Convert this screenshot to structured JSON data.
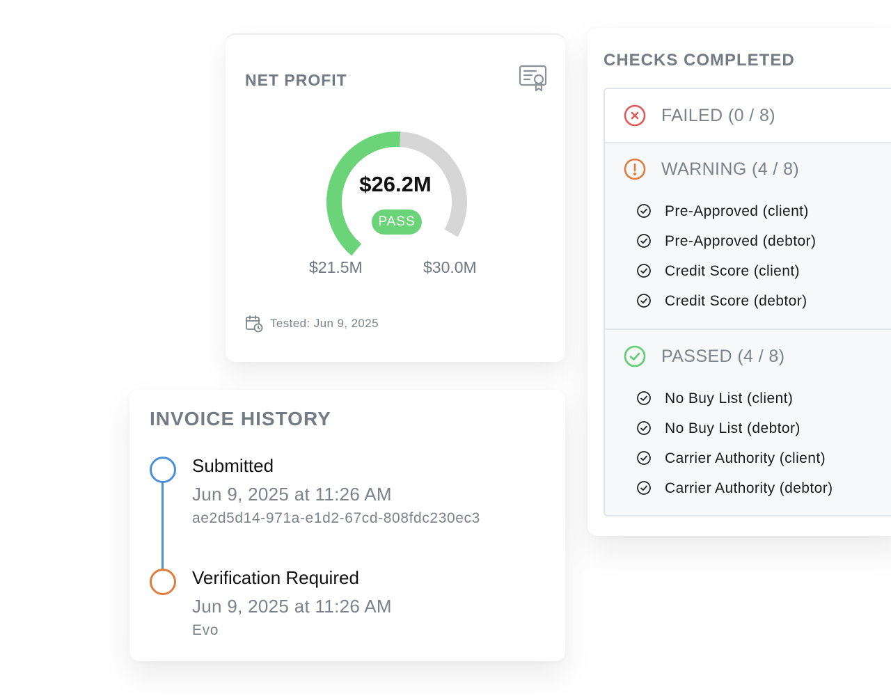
{
  "net_profit": {
    "title": "NET PROFIT",
    "value": "$26.2M",
    "status": "PASS",
    "progress_fraction": 0.55,
    "min_label": "$21.5M",
    "max_label": "$30.0M",
    "tested": "Tested: Jun 9, 2025",
    "colors": {
      "progress": "#6cd478",
      "track": "#d6d6d6"
    }
  },
  "invoice_history": {
    "title": "INVOICE HISTORY",
    "events": [
      {
        "title": "Submitted",
        "date": "Jun 9, 2025 at 11:26 AM",
        "sub": "ae2d5d14-971a-e1d2-67cd-808fdc230ec3",
        "color": "#4a90d9"
      },
      {
        "title": "Verification Required",
        "date": "Jun 9, 2025 at 11:26 AM",
        "sub": "Evo",
        "color": "#e07b39"
      }
    ]
  },
  "checks": {
    "title": "CHECKS COMPLETED",
    "failed": {
      "label": "FAILED (0 / 8)",
      "color": "#e05a5a",
      "icon": "x-circle-icon"
    },
    "warning": {
      "label": "WARNING (4 / 8)",
      "color": "#e07b39",
      "icon": "exclamation-circle-icon",
      "items": [
        "Pre-Approved (client)",
        "Pre-Approved (debtor)",
        "Credit Score (client)",
        "Credit Score (debtor)"
      ]
    },
    "passed": {
      "label": "PASSED (4 / 8)",
      "color": "#5ccf72",
      "icon": "check-circle-icon",
      "items": [
        "No Buy List (client)",
        "No Buy List (debtor)",
        "Carrier Authority (client)",
        "Carrier Authority (debtor)"
      ]
    }
  }
}
